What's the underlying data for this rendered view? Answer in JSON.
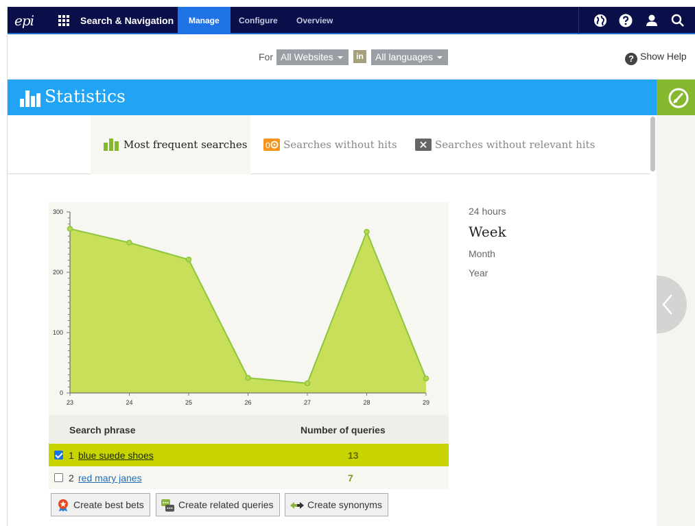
{
  "nav": {
    "logo": "epi",
    "app_title": "Search & Navigation",
    "tabs": [
      {
        "label": "Manage",
        "active": true
      },
      {
        "label": "Configure",
        "active": false
      },
      {
        "label": "Overview",
        "active": false
      }
    ],
    "icons": [
      "globe-icon",
      "help-icon",
      "user-icon",
      "search-icon"
    ]
  },
  "filter": {
    "for_label": "For",
    "site_select": "All Websites",
    "in_label": "in",
    "language_select": "All languages",
    "show_help": "Show Help"
  },
  "header": {
    "title": "Statistics",
    "accent": "#20a4f3",
    "corner_color": "#86b82f"
  },
  "subtabs": [
    {
      "label": "Most frequent searches",
      "active": true
    },
    {
      "label": "Searches without hits",
      "active": false
    },
    {
      "label": "Searches without relevant hits",
      "active": false
    }
  ],
  "ranges": {
    "h24": "24 hours",
    "week": "Week",
    "month": "Month",
    "year": "Year",
    "active": "Week"
  },
  "chart_data": {
    "type": "area",
    "x": [
      "23",
      "24",
      "25",
      "26",
      "27",
      "28",
      "29"
    ],
    "values": [
      272,
      249,
      221,
      25,
      16,
      267,
      24
    ],
    "yticks": [
      0,
      100,
      200,
      300
    ],
    "ylim": [
      0,
      300
    ],
    "fill_color": "#c8df5a",
    "line_color": "#8cc63f",
    "title": "",
    "xlabel": "",
    "ylabel": ""
  },
  "table": {
    "col_phrase": "Search phrase",
    "col_count": "Number of queries",
    "rows": [
      {
        "rank": "1",
        "phrase": "blue suede shoes",
        "count": "13",
        "checked": true
      },
      {
        "rank": "2",
        "phrase": "red mary janes",
        "count": "7",
        "checked": false
      }
    ]
  },
  "buttons": {
    "best_bets": "Create best bets",
    "related": "Create related queries",
    "synonyms": "Create synonyms"
  }
}
